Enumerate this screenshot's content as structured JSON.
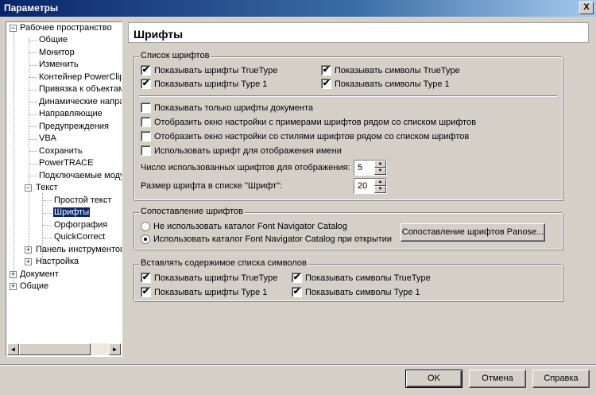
{
  "window": {
    "title": "Параметры",
    "close_label": "X"
  },
  "tree": {
    "items": [
      {
        "label": "Рабочее пространство",
        "expander": "−"
      },
      {
        "label": "Общие"
      },
      {
        "label": "Монитор"
      },
      {
        "label": "Изменить"
      },
      {
        "label": "Контейнер PowerClip"
      },
      {
        "label": "Привязка к объектам"
      },
      {
        "label": "Динамические направляющие"
      },
      {
        "label": "Направляющие"
      },
      {
        "label": "Предупреждения"
      },
      {
        "label": "VBA"
      },
      {
        "label": "Сохранить"
      },
      {
        "label": "PowerTRACE"
      },
      {
        "label": "Подключаемые модули"
      },
      {
        "label": "Текст",
        "expander": "−"
      },
      {
        "label": "Простой текст"
      },
      {
        "label": "Шрифты",
        "selected": true
      },
      {
        "label": "Орфография"
      },
      {
        "label": "QuickCorrect"
      },
      {
        "label": "Панель инструментов",
        "expander": "+"
      },
      {
        "label": "Настройка",
        "expander": "+"
      },
      {
        "label": "Документ",
        "expander": "+"
      },
      {
        "label": "Общие",
        "expander": "+"
      }
    ],
    "scroll_left": "◄",
    "scroll_right": "►"
  },
  "panel": {
    "title": "Шрифты",
    "font_list": {
      "title": "Список шрифтов",
      "show_truetype_fonts": {
        "label": "Показывать шрифты TrueType",
        "checked": true
      },
      "show_type1_fonts": {
        "label": "Показывать шрифты Type 1",
        "checked": true
      },
      "show_truetype_symbols": {
        "label": "Показывать символы TrueType",
        "checked": true
      },
      "show_type1_symbols": {
        "label": "Показывать символы Type 1",
        "checked": true
      },
      "only_document_fonts": {
        "label": "Показывать только шрифты документа",
        "checked": false
      },
      "show_sample_window": {
        "label": "Отобразить окно настройки с примерами шрифтов рядом со списком шрифтов",
        "checked": false
      },
      "show_style_window": {
        "label": "Отобразить окно настройки со стилями шрифтов рядом со списком шрифтов",
        "checked": false
      },
      "use_font_for_name": {
        "label": "Использовать шрифт для отображения имени",
        "checked": false
      },
      "recent_fonts_count": {
        "label": "Число использованных шрифтов для отображения:",
        "value": "5"
      },
      "font_size_in_list": {
        "label": "Размер шрифта в списке \"Шрифт\":",
        "value": "20"
      }
    },
    "font_matching": {
      "title": "Сопоставление шрифтов",
      "no_catalog": {
        "label": "Не использовать каталог Font Navigator Catalog",
        "selected": false
      },
      "use_catalog": {
        "label": "Использовать каталог Font Navigator Catalog при открытии",
        "selected": true
      },
      "panose_button": "Сопоставление шрифтов Panose..."
    },
    "symbol_list": {
      "title": "Вставлять содержимое списка символов",
      "show_truetype_fonts": {
        "label": "Показывать шрифты TrueType",
        "checked": true
      },
      "show_type1_fonts": {
        "label": "Показывать шрифты Type 1",
        "checked": true
      },
      "show_truetype_symbols": {
        "label": "Показывать символы TrueType",
        "checked": true
      },
      "show_type1_symbols": {
        "label": "Показывать символы Type 1",
        "checked": true
      }
    }
  },
  "footer": {
    "ok": "OK",
    "cancel": "Отмена",
    "help": "Справка"
  },
  "marks": {
    "check": "✔",
    "spin_up": "▲",
    "spin_down": "▼"
  }
}
